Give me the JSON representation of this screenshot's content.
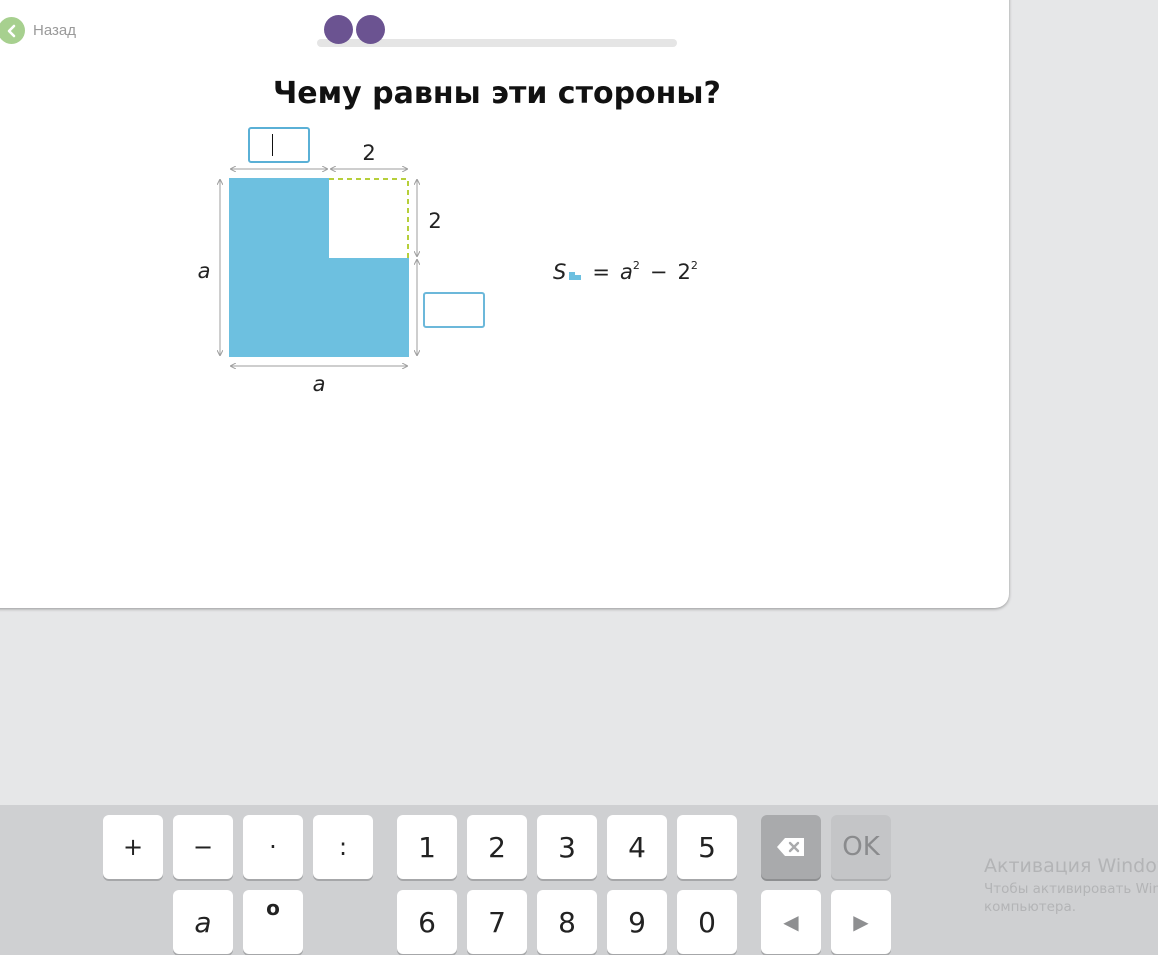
{
  "nav": {
    "back_label": "Назад"
  },
  "progress": {
    "completed_steps": 2
  },
  "question": {
    "title": "Чему равны эти стороны?"
  },
  "figure": {
    "labels": {
      "top_right": "2",
      "right_top": "2",
      "left": "a",
      "bottom": "a"
    },
    "answers": {
      "top_value": "",
      "right_value": ""
    },
    "colors": {
      "fill": "#6dc0e0",
      "dashed": "#b6cf3a",
      "dimension": "#9e9e9e"
    }
  },
  "formula": {
    "lhs": "S",
    "equals": "=",
    "var": "a",
    "exp1": "2",
    "minus": "−",
    "num": "2",
    "exp2": "2"
  },
  "keyboard": {
    "row1": [
      "+",
      "−",
      "·",
      ":",
      "1",
      "2",
      "3",
      "4",
      "5"
    ],
    "row2": [
      "a",
      "6",
      "7",
      "8",
      "9",
      "0"
    ],
    "degree_symbol": "o",
    "ok_label": "OK",
    "left_arrow": "◀",
    "right_arrow": "▶"
  },
  "watermark": {
    "title": "Активация Windows",
    "line1": "Чтобы активировать Windows, перейдите в раздел",
    "line2": "компьютера."
  },
  "colors": {
    "accent": "#6b5391",
    "back": "#a7d08f",
    "input_border": "#5ab0d6"
  }
}
